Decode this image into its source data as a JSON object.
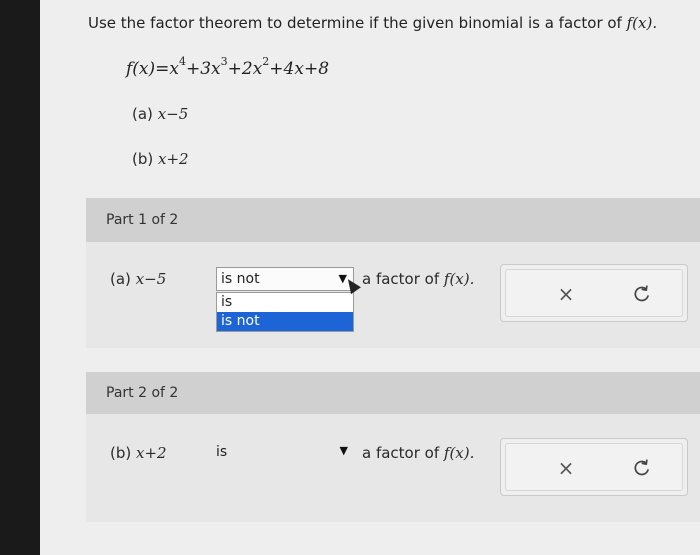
{
  "prompt": {
    "text": "Use the factor theorem to determine if the given binomial is a factor of ",
    "function_ref": "f(x)."
  },
  "polynomial": {
    "lhs": "f(x)=x",
    "exp1": "4",
    "t2": "+3x",
    "exp2": "3",
    "t3": "+2x",
    "exp3": "2",
    "t4": "+4x+8"
  },
  "items": [
    {
      "label": "(a)",
      "binomial": "x−5"
    },
    {
      "label": "(b)",
      "binomial": "x+2"
    }
  ],
  "part1": {
    "title": "Part 1 of 2",
    "row_label": "(a)",
    "row_binomial": "x−5",
    "select_value": "is not",
    "options": [
      "is",
      "is not"
    ],
    "after_text": "a factor of ",
    "after_func": "f(x)."
  },
  "part2": {
    "title": "Part 2 of 2",
    "row_label": "(b)",
    "row_binomial": "x+2",
    "select_value": "is",
    "after_text": "a factor of ",
    "after_func": "f(x)."
  },
  "actions": {
    "clear_glyph": "×",
    "redo_icon": "redo-icon"
  },
  "colors": {
    "selected_option": "#1d64d6",
    "part_header": "#d0d0d0"
  }
}
